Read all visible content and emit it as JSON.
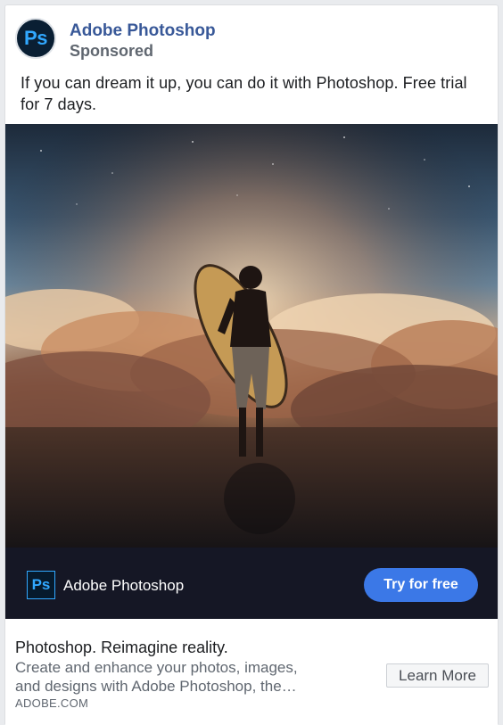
{
  "header": {
    "page_name": "Adobe Photoshop",
    "sponsored_label": "Sponsored",
    "avatar_glyph": "Ps"
  },
  "post": {
    "text": "If you can dream it up, you can do it with Photoshop. Free trial for 7 days."
  },
  "creative": {
    "logo_glyph": "Ps",
    "brand_name": "Adobe Photoshop",
    "cta_label": "Try for free"
  },
  "link": {
    "headline": "Photoshop. Reimagine reality.",
    "description_line1": "Create and enhance your photos, images,",
    "description_line2": "and designs with Adobe Photoshop, the…",
    "domain": "ADOBE.COM",
    "cta_label": "Learn More"
  },
  "colors": {
    "page_name": "#385898",
    "photoshop_blue": "#31a8ff",
    "cta_blue": "#3b78e7",
    "brand_bar": "#151725"
  },
  "icons": {
    "avatar": "photoshop-logo-icon",
    "bar_logo": "photoshop-logo-icon"
  }
}
